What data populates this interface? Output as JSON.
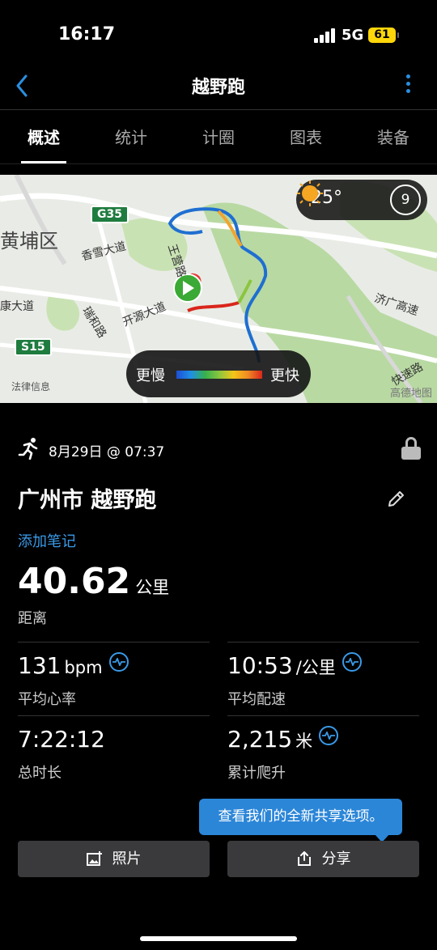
{
  "status_bar": {
    "time": "16:17",
    "network": "5G",
    "battery": "61"
  },
  "nav": {
    "title": "越野跑"
  },
  "tabs": [
    {
      "label": "概述",
      "active": true
    },
    {
      "label": "统计",
      "active": false
    },
    {
      "label": "计圈",
      "active": false
    },
    {
      "label": "图表",
      "active": false
    },
    {
      "label": "装备",
      "active": false
    }
  ],
  "map": {
    "labels": {
      "district": "黄埔区",
      "road1": "香雪大道",
      "road2": "开源大道",
      "road3": "王营路",
      "road4": "瑞和路",
      "road5": "济广高速",
      "road6": "康大道",
      "road7": "快速路"
    },
    "badges": {
      "g35": "G35",
      "s15": "S15"
    },
    "weather": {
      "temperature": "25°",
      "moon_phase": "9"
    },
    "legend": {
      "slow": "更慢",
      "fast": "更快"
    },
    "copyright_left": "法律信息",
    "copyright_right": "高德地图"
  },
  "activity": {
    "date": "8月29日 @ 07:37",
    "title": "广州市 越野跑",
    "add_note": "添加笔记",
    "distance": {
      "value": "40.62",
      "unit": "公里",
      "label": "距离"
    }
  },
  "stats": {
    "heart_rate": {
      "value": "131",
      "unit": "bpm",
      "label": "平均心率"
    },
    "pace": {
      "value": "10:53",
      "unit": "/公里",
      "label": "平均配速"
    },
    "duration": {
      "value": "7:22:12",
      "label": "总时长"
    },
    "ascent": {
      "value": "2,215",
      "unit": "米",
      "label": "累计爬升"
    }
  },
  "tooltip": "查看我们的全新共享选项。",
  "buttons": {
    "photos": "照片",
    "share": "分享"
  },
  "colors": {
    "accent": "#3a9ae8",
    "map_bg": "#e9ece6",
    "highway": "#1f7c3f"
  }
}
